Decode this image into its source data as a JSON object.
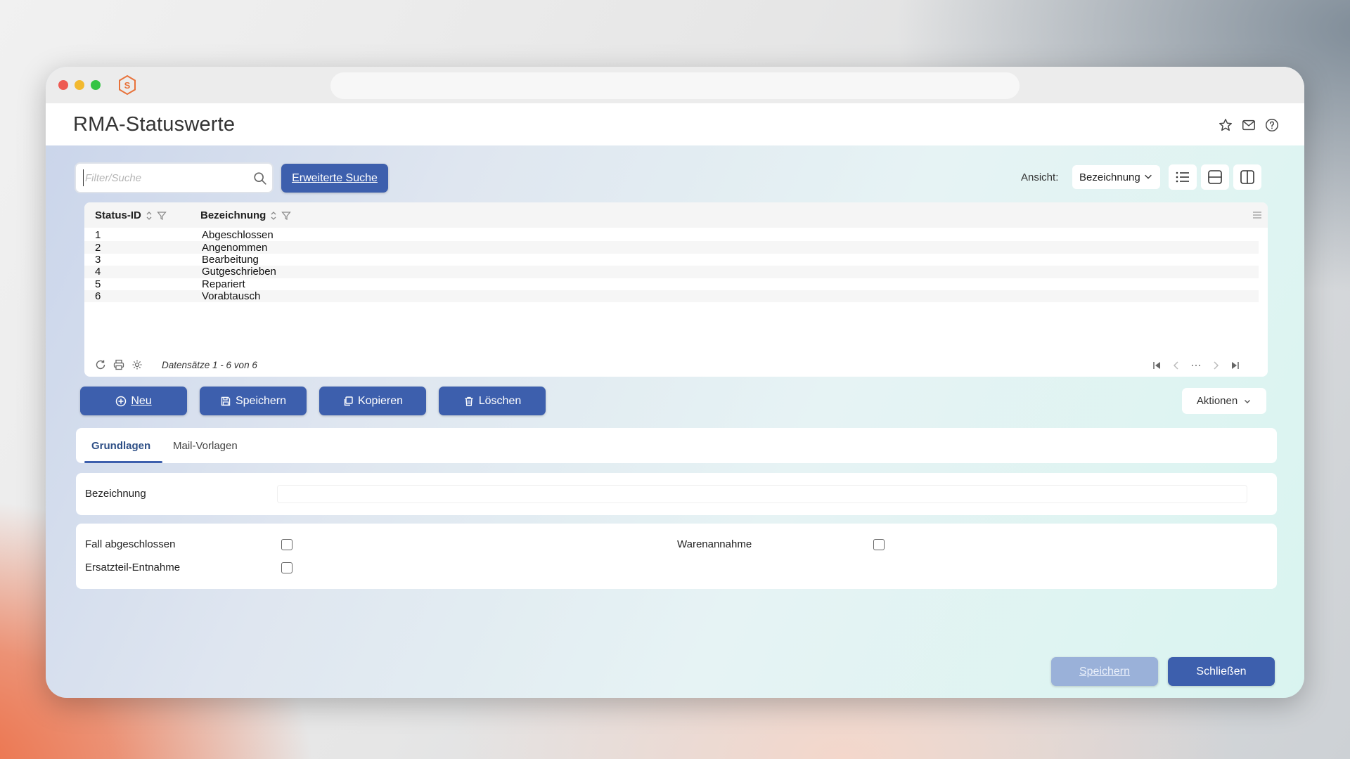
{
  "page": {
    "title": "RMA-Statuswerte"
  },
  "toolbar": {
    "search_placeholder": "Filter/Suche",
    "extended_search_label": "Erweiterte Suche",
    "view_label": "Ansicht:",
    "view_selected": "Bezeichnung"
  },
  "grid": {
    "columns": [
      "Status-ID",
      "Bezeichnung"
    ],
    "rows": [
      {
        "id": "1",
        "name": "Abgeschlossen"
      },
      {
        "id": "2",
        "name": "Angenommen"
      },
      {
        "id": "3",
        "name": "Bearbeitung"
      },
      {
        "id": "4",
        "name": "Gutgeschrieben"
      },
      {
        "id": "5",
        "name": "Repariert"
      },
      {
        "id": "6",
        "name": "Vorabtausch"
      }
    ],
    "record_info": "Datensätze 1 - 6 von 6"
  },
  "actions": {
    "new_label": "Neu",
    "save_label": "Speichern",
    "copy_label": "Kopieren",
    "delete_label": "Löschen",
    "more_label": "Aktionen"
  },
  "tabs": [
    {
      "label": "Grundlagen",
      "active": true
    },
    {
      "label": "Mail-Vorlagen",
      "active": false
    }
  ],
  "form": {
    "bezeichnung_label": "Bezeichnung",
    "bezeichnung_value": "",
    "fall_abgeschlossen_label": "Fall abgeschlossen",
    "ersatzteil_label": "Ersatzteil-Entnahme",
    "warenannahme_label": "Warenannahme",
    "fall_abgeschlossen_checked": false,
    "ersatzteil_checked": false,
    "warenannahme_checked": false
  },
  "footer": {
    "save_label": "Speichern",
    "close_label": "Schließen"
  },
  "colors": {
    "primary": "#3d5fad",
    "primary_disabled": "#9ab1d9",
    "brand_logo": "#e8723a"
  }
}
